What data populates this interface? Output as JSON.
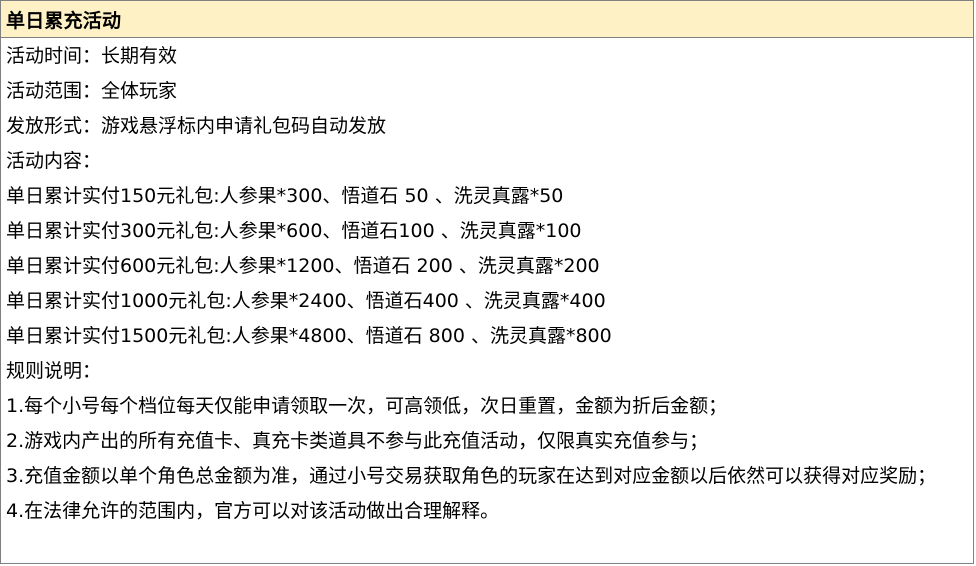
{
  "header": {
    "title": "单日累充活动"
  },
  "lines": [
    "活动时间：长期有效",
    "活动范围：全体玩家",
    "发放形式：游戏悬浮标内申请礼包码自动发放",
    "活动内容：",
    "单日累计实付150元礼包:人参果*300、悟道石 50 、洗灵真露*50",
    "单日累计实付300元礼包:人参果*600、悟道石100 、洗灵真露*100",
    "单日累计实付600元礼包:人参果*1200、悟道石 200 、洗灵真露*200",
    "单日累计实付1000元礼包:人参果*2400、悟道石400 、洗灵真露*400",
    "单日累计实付1500元礼包:人参果*4800、悟道石 800 、洗灵真露*800",
    "规则说明：",
    "1.每个小号每个档位每天仅能申请领取一次，可高领低，次日重置，金额为折后金额；",
    "2.游戏内产出的所有充值卡、真充卡类道具不参与此充值活动，仅限真实充值参与；",
    "3.充值金额以单个角色总金额为准，通过小号交易获取角色的玩家在达到对应金额以后依然可以获得对应奖励；",
    "4.在法律允许的范围内，官方可以对该活动做出合理解释。"
  ]
}
